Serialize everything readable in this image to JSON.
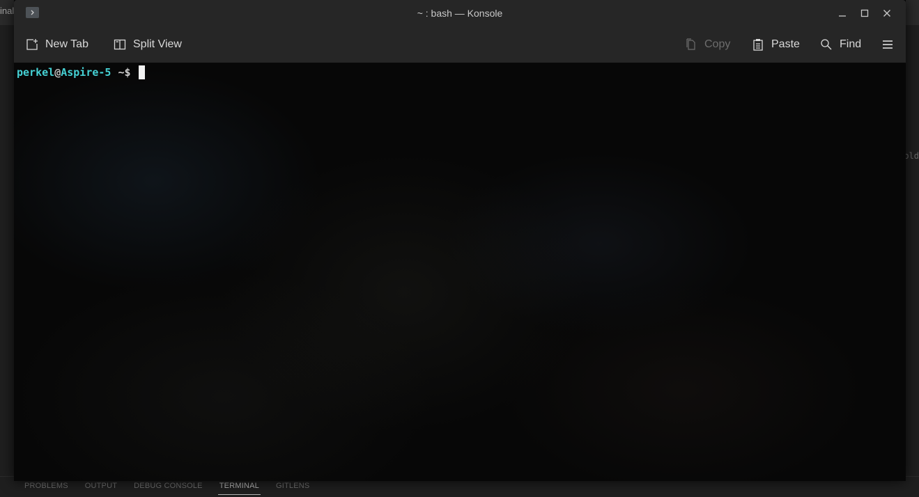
{
  "background_editor": {
    "left_fragment": "inal",
    "right_fragment": "old",
    "panel_tabs": [
      {
        "label": "PROBLEMS",
        "active": false
      },
      {
        "label": "OUTPUT",
        "active": false
      },
      {
        "label": "DEBUG CONSOLE",
        "active": false
      },
      {
        "label": "TERMINAL",
        "active": true
      },
      {
        "label": "GITLENS",
        "active": false
      }
    ]
  },
  "window": {
    "title": "~ : bash — Konsole",
    "app_icon": "konsole-terminal-icon"
  },
  "toolbar": {
    "new_tab": "New Tab",
    "split_view": "Split View",
    "copy": "Copy",
    "paste": "Paste",
    "find": "Find"
  },
  "terminal": {
    "user": "perkel",
    "at": "@",
    "host": "Aspire-5",
    "dir_prompt": "~$"
  },
  "colors": {
    "prompt_user": "#45d1d4",
    "titlebar": "#262626",
    "terminal_bg": "#070707"
  }
}
